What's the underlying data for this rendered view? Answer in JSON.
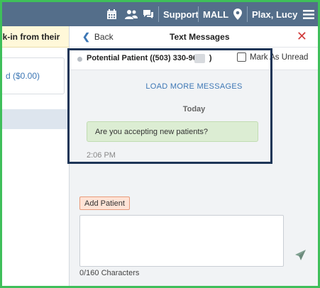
{
  "topbar": {
    "icons": [
      "calendar-icon",
      "users-icon",
      "chat-icon"
    ],
    "support_label": "Support",
    "location_label": "MALL",
    "user_label": "Plax, Lucy"
  },
  "left_page": {
    "banner_text": "ck-in from their",
    "card_value": "d ($0.00)"
  },
  "panel": {
    "back_label": "Back",
    "title": "Text Messages",
    "close_label": "✕",
    "contact_name": "Potential Patient ((503) 330-96",
    "contact_suffix": ")",
    "mark_unread_label": "Mark As Unread",
    "load_more_label": "LOAD MORE MESSAGES",
    "day_label": "Today",
    "message_text": "Are you accepting new patients?",
    "message_time": "2:06 PM",
    "add_patient_label": "Add Patient",
    "message_input_value": "",
    "char_count": "0/160 Characters"
  },
  "colors": {
    "topbar": "#546e8a",
    "frame": "#3fbf5a",
    "highlight": "#1d3557",
    "bubble": "#dcedd3",
    "link": "#3d77b5",
    "close": "#d13b3b"
  }
}
